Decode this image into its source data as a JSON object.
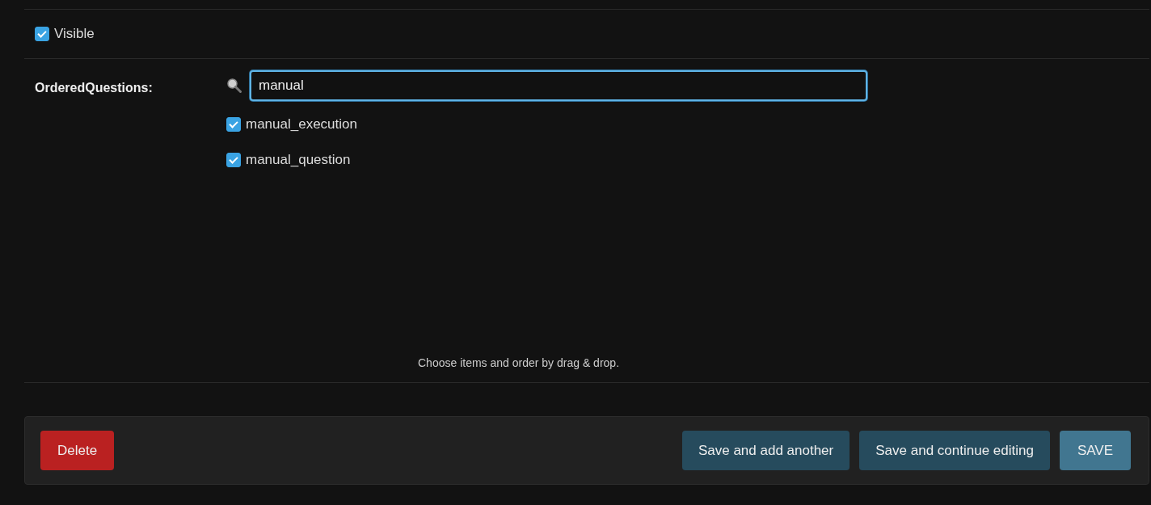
{
  "visible": {
    "label": "Visible",
    "checked": true
  },
  "ordered_questions": {
    "label": "OrderedQuestions:",
    "search": {
      "value": "manual"
    },
    "items": [
      {
        "label": "manual_execution",
        "checked": true
      },
      {
        "label": "manual_question",
        "checked": true
      }
    ],
    "help": "Choose items and order by drag & drop."
  },
  "buttons": [
    {
      "label": "Delete",
      "kind": "delete"
    },
    {
      "label": "Save and add another",
      "kind": "secondary"
    },
    {
      "label": "Save and continue editing",
      "kind": "secondary"
    },
    {
      "label": "SAVE",
      "kind": "primary"
    }
  ]
}
